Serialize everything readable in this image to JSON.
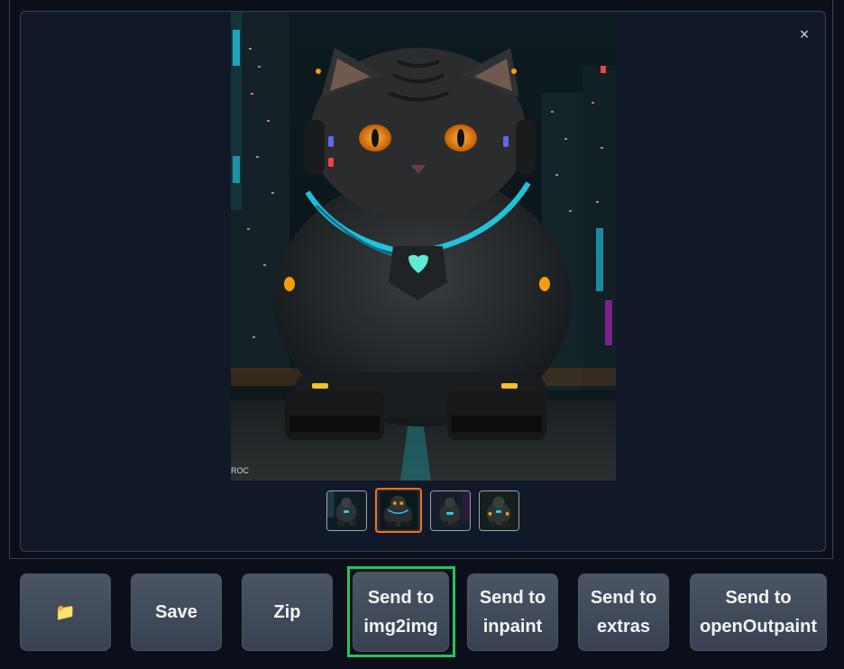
{
  "gallery": {
    "close_label": "×",
    "image_signature": "ROC",
    "thumbnails": [
      {
        "name": "thumb-1",
        "selected": false
      },
      {
        "name": "thumb-2",
        "selected": true
      },
      {
        "name": "thumb-3",
        "selected": false
      },
      {
        "name": "thumb-4",
        "selected": false
      }
    ]
  },
  "actions": {
    "folder_icon": "📁",
    "save": "Save",
    "zip": "Zip",
    "send_img2img": "Send to\nimg2img",
    "send_inpaint": "Send to\ninpaint",
    "send_extras": "Send to\nextras",
    "send_outpaint": "Send to\nopenOutpaint"
  },
  "colors": {
    "background": "#0b0f19",
    "panel": "#111827",
    "button": "#374151",
    "selected_thumb_border": "#f97316",
    "focus_ring": "#22c55e",
    "neon_cyan": "#22d3ee"
  }
}
